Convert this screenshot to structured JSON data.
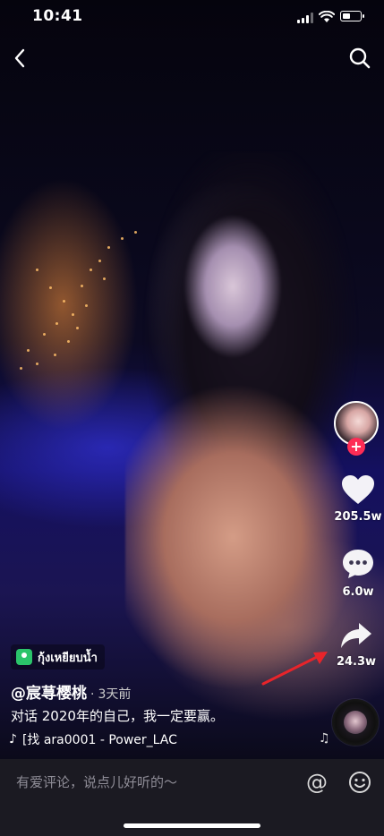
{
  "status_bar": {
    "time": "10:41",
    "battery_level": 0.45
  },
  "icons": {
    "back": "chevron-left-icon",
    "search": "search-icon",
    "like": "heart-icon",
    "comment": "comment-bubble-icon",
    "share": "share-arrow-icon",
    "follow": "plus-icon",
    "emoji": "smiley-icon",
    "music_note": "music-note-icon"
  },
  "actions": {
    "follow_symbol": "+",
    "likes": "205.5w",
    "comments": "6.0w",
    "shares": "24.3w"
  },
  "post": {
    "location": "กุ้งเหยียบน้ำ",
    "author": "@宸荨樱桃",
    "separator": "·",
    "time_ago": "3天前",
    "caption": "对话 2020年的自己，我一定要赢。",
    "music": "[找 ara0001 - Power_LAC",
    "music_logo": "♪",
    "note_glyph": "♫"
  },
  "comment_bar": {
    "placeholder": "有爱评论，说点儿好听的～",
    "at_symbol": "@"
  },
  "colors": {
    "accent_red": "#fe2c55",
    "location_green": "#2bc46a",
    "annotation_arrow": "#e8242a",
    "bottom_bar": "#1b1a22"
  }
}
